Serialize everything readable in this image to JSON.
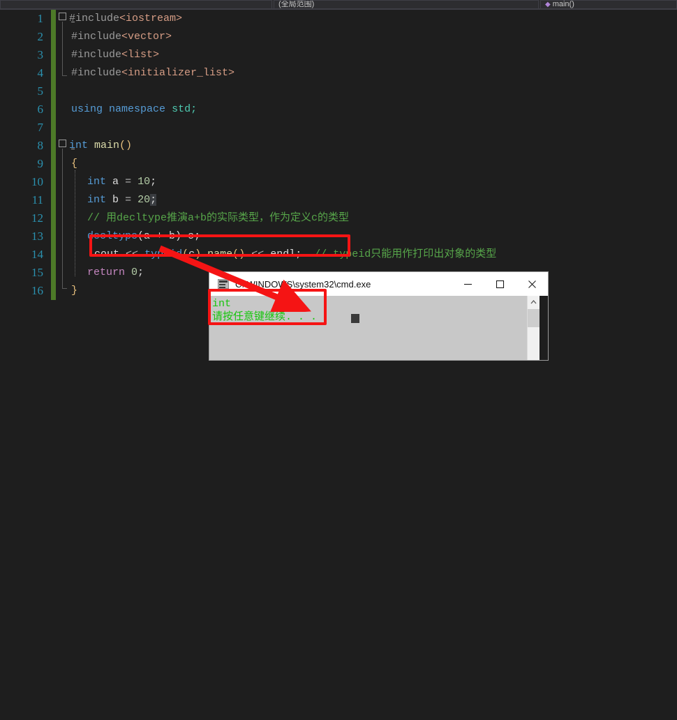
{
  "topbar": {
    "project_label": "",
    "scope_label": "(全局范围)",
    "member_label": "main()",
    "member_icon": "method-icon"
  },
  "editor": {
    "language": "cpp",
    "line_numbers": [
      1,
      2,
      3,
      4,
      5,
      6,
      7,
      8,
      9,
      10,
      11,
      12,
      13,
      14,
      15,
      16
    ],
    "lines": [
      {
        "n": 1,
        "text": "#include<iostream>"
      },
      {
        "n": 2,
        "text": "#include<vector>"
      },
      {
        "n": 3,
        "text": "#include<list>"
      },
      {
        "n": 4,
        "text": "#include<initializer_list>"
      },
      {
        "n": 5,
        "text": ""
      },
      {
        "n": 6,
        "text": "using namespace std;"
      },
      {
        "n": 7,
        "text": ""
      },
      {
        "n": 8,
        "text": "int main()"
      },
      {
        "n": 9,
        "text": "{"
      },
      {
        "n": 10,
        "text": "int a = 10;"
      },
      {
        "n": 11,
        "text": "int b = 20;"
      },
      {
        "n": 12,
        "text": "// 用decltype推演a+b的实际类型，作为定义c的类型"
      },
      {
        "n": 13,
        "text": "decltype(a + b) c;"
      },
      {
        "n": 14,
        "text": "cout << typeid(c).name() << endl;  // typeid只能用作打印出对象的类型"
      },
      {
        "n": 15,
        "text": "return 0;"
      },
      {
        "n": 16,
        "text": "}"
      }
    ],
    "tokens": {
      "inc_iostream": "<iostream>",
      "inc_vector": "<vector>",
      "inc_list": "<list>",
      "inc_initializer_list": "<initializer_list>",
      "hash_include": "#include",
      "kw_using": "using",
      "kw_namespace": "namespace",
      "id_std": "std;",
      "kw_int": "int",
      "fn_main": "main",
      "parens": "()",
      "brace_open": "{",
      "brace_close": "}",
      "var_a": "a",
      "var_b": "b",
      "var_c": "c",
      "eq": "=",
      "num_10": "10",
      "num_20": "20",
      "semi": ";",
      "comment_12": "// 用decltype推演a+b的实际类型，作为定义c的类型",
      "kw_decltype": "decltype",
      "expr_ab": "(a + b)",
      "id_cout": "cout",
      "op_shift": "<<",
      "kw_typeid": "typeid",
      "dot": ".",
      "fn_name": "name",
      "id_endl": "endl",
      "comment_14": "// typeid只能用作打印出对象的类型",
      "kw_return": "return",
      "num_0": "0"
    },
    "collapse_markers": [
      "collapse-line-1",
      "collapse-line-8"
    ],
    "collapse_glyph": "−",
    "change_bar_color": "#4d7a28"
  },
  "annotations": {
    "color": "#f51414",
    "box_code_target": "cout << typeid(c).name() << endl;",
    "box_console_target": "int",
    "arrow_label": "arrow-code-to-output"
  },
  "console": {
    "title": "C:\\WINDOWS\\system32\\cmd.exe",
    "app_icon": "cmd-icon",
    "minimize_label": "—",
    "maximize_label": "▢",
    "close_label": "✕",
    "output_lines": [
      "int",
      "请按任意键继续. . ."
    ],
    "text_color": "#16c60c",
    "background_color": "#c8c8c8",
    "scroll_up_glyph": "⌃"
  }
}
